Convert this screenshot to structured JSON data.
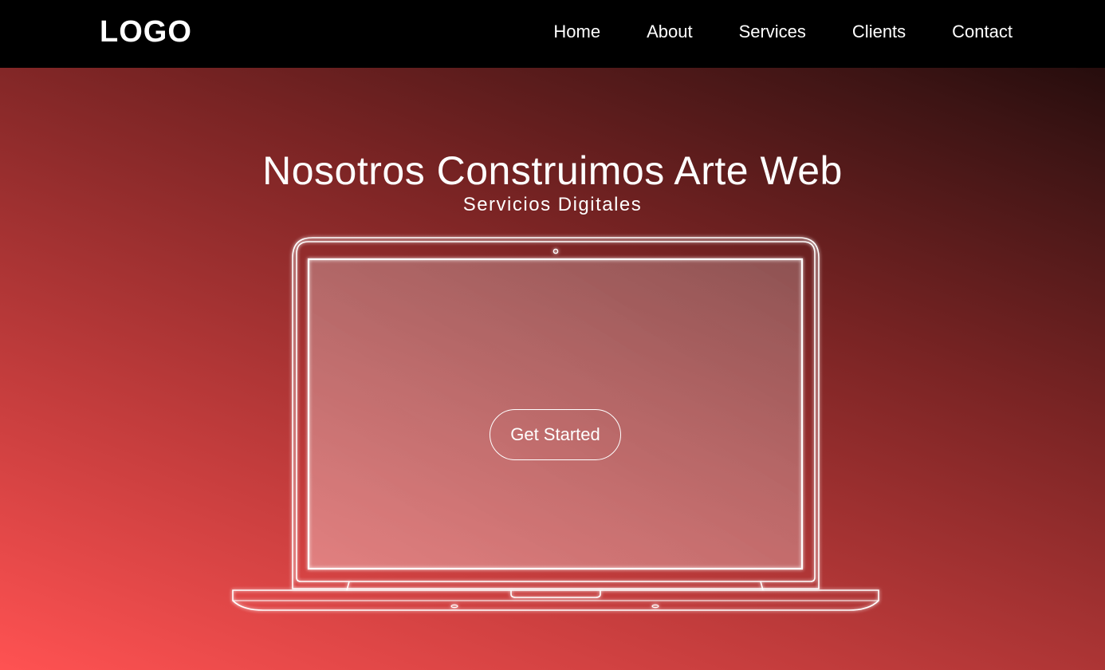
{
  "header": {
    "logo": "LOGO",
    "nav": [
      {
        "label": "Home"
      },
      {
        "label": "About"
      },
      {
        "label": "Services"
      },
      {
        "label": "Clients"
      },
      {
        "label": "Contact"
      }
    ]
  },
  "hero": {
    "title": "Nosotros Construimos Arte Web",
    "subtitle": "Servicios Digitales",
    "cta_label": "Get Started"
  },
  "colors": {
    "navbar": "#000000",
    "gradient_bottom_left": "#ff5252",
    "gradient_top_right": "#150707",
    "text": "#ffffff"
  },
  "icons": {
    "laptop": "laptop-outline-icon",
    "camera": "webcam-icon"
  }
}
